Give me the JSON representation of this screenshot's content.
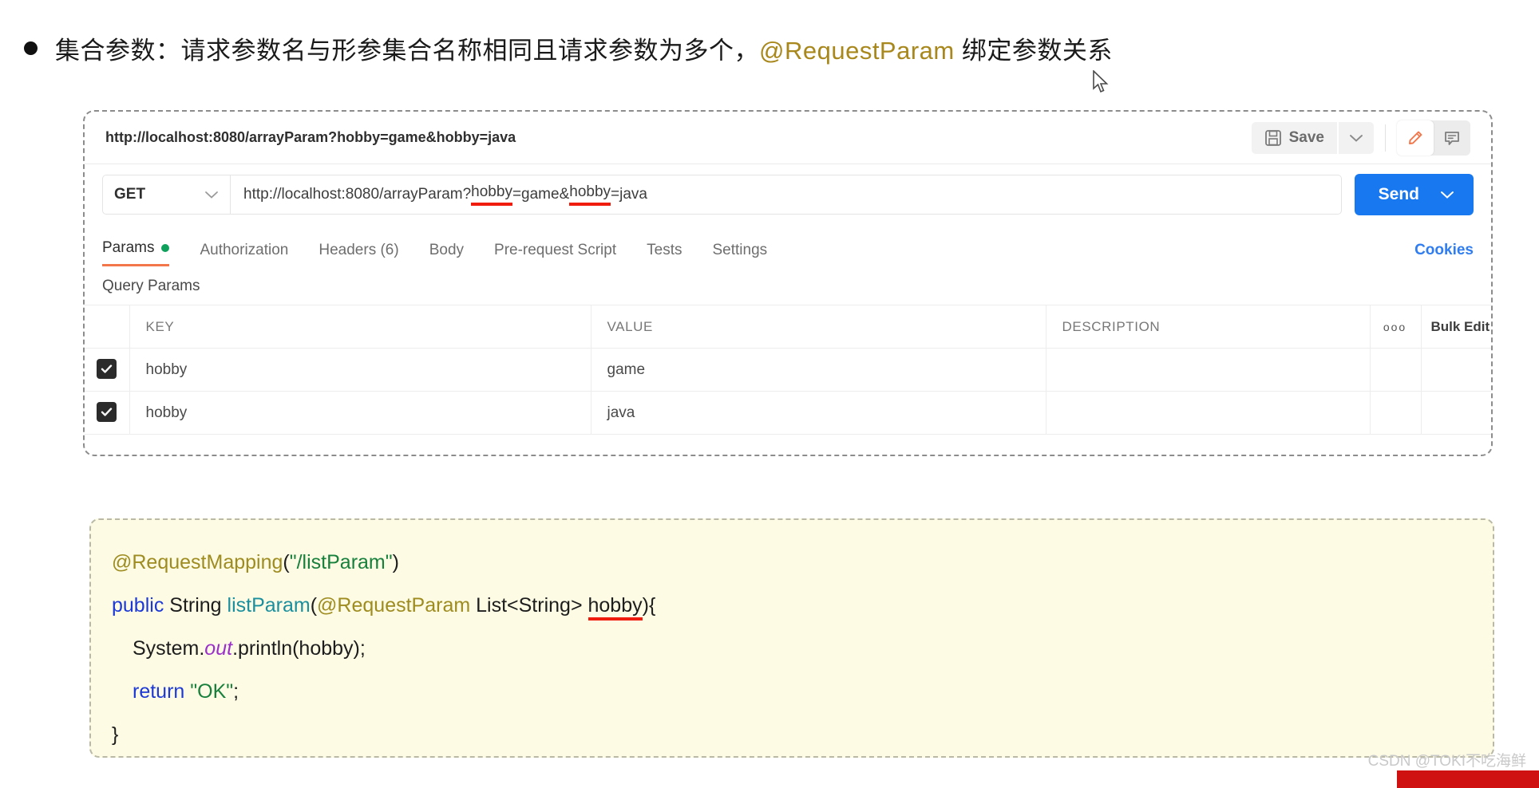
{
  "headline": {
    "bullet": "•",
    "text_before": "集合参数：请求参数名与形参集合名称相同且请求参数为多个，",
    "annotation": "@RequestParam",
    "text_after": " 绑定参数关系"
  },
  "postman": {
    "tab_title": "http://localhost:8080/arrayParam?hobby=game&hobby=java",
    "save_label": "Save",
    "save_icon": "floppy-disk-icon",
    "save_caret_icon": "chevron-down-icon",
    "edit_icon": "pencil-icon",
    "comment_icon": "comment-icon",
    "method": "GET",
    "method_caret_icon": "chevron-down-icon",
    "url_parts": {
      "p1": "http://localhost:8080/arrayParam?",
      "u1": "hobby",
      "p2": "=game&",
      "u2": "hobby",
      "p3": "=java"
    },
    "send_label": "Send",
    "send_caret_icon": "chevron-down-icon",
    "tabs": [
      {
        "label": "Params",
        "active": true,
        "dot": true
      },
      {
        "label": "Authorization",
        "active": false,
        "dot": false
      },
      {
        "label": "Headers (6)",
        "active": false,
        "dot": false
      },
      {
        "label": "Body",
        "active": false,
        "dot": false
      },
      {
        "label": "Pre-request Script",
        "active": false,
        "dot": false
      },
      {
        "label": "Tests",
        "active": false,
        "dot": false
      },
      {
        "label": "Settings",
        "active": false,
        "dot": false
      }
    ],
    "cookies_label": "Cookies",
    "query_params_label": "Query Params",
    "table": {
      "headers": {
        "key": "KEY",
        "value": "VALUE",
        "description": "DESCRIPTION",
        "dots": "ooo",
        "bulk_edit": "Bulk Edit"
      },
      "rows": [
        {
          "checked": true,
          "key": "hobby",
          "value": "game",
          "description": ""
        },
        {
          "checked": true,
          "key": "hobby",
          "value": "java",
          "description": ""
        }
      ]
    }
  },
  "code": {
    "line1": {
      "annotation": "@RequestMapping",
      "paren_open": "(",
      "string": "\"/listParam\"",
      "paren_close": ")"
    },
    "line2": {
      "kw": "public",
      "type": " String ",
      "method": "listParam",
      "paren_open": "(",
      "annotation": "@RequestParam",
      "param_type": " List<String> ",
      "param_name": "hobby",
      "tail": "){"
    },
    "line3": {
      "pre": "System.",
      "static_field": "out",
      "post": ".println(hobby);"
    },
    "line4": {
      "kw": "return",
      "space": " ",
      "string": "\"OK\"",
      "semi": ";"
    },
    "line5": "}"
  },
  "watermark": {
    "text": "CSDN @TOKI不吃海鲜"
  },
  "colors": {
    "accent_blue": "#1878f0",
    "tab_orange": "#f2764a",
    "underline_red": "#f01d0e",
    "annotation_gold": "#9e8c20",
    "string_green": "#17803d",
    "keyword_blue": "#1c39d6",
    "method_teal": "#1a8f9e",
    "static_purple": "#9b30c9",
    "dot_green": "#0fa15c",
    "code_bg": "#fdfbe3"
  }
}
